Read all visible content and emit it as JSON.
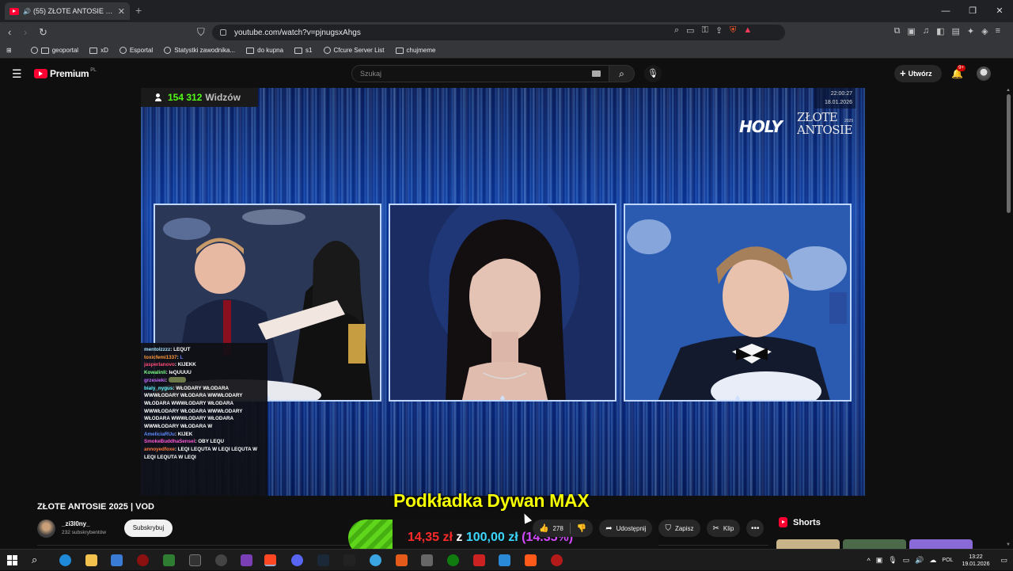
{
  "browser": {
    "tab_title": "(55) ZŁOTE ANTOSIE 2025 | V",
    "tab_close": "✕",
    "new_tab": "+",
    "window_controls": [
      "—",
      "❐",
      "✕"
    ],
    "url": "youtube.com/watch?v=pjnugsxAhgs",
    "bookmarks": [
      "geoportal",
      "xD",
      "Esportal",
      "Statystki zawodnika...",
      "do kupna",
      "s1",
      "Cfcure Server List",
      "chujmeme"
    ]
  },
  "youtube": {
    "logo_text": "Premium",
    "logo_suffix": "PL",
    "search_placeholder": "Szukaj",
    "create_label": "Utwórz",
    "notifications_badge": "9+"
  },
  "stream": {
    "viewers_count": "154 312",
    "viewers_label": "Widzów",
    "stamp_time": "22:00:27",
    "stamp_date": "18.01.2026",
    "brand_holy": "HOLY",
    "brand_line1": "ZŁOTE",
    "brand_line2": "ANTOSIE",
    "brand_year": "2025"
  },
  "chat": [
    {
      "user": "mentoIzzzz",
      "color": "#a7e3ff",
      "text": "LEQUT"
    },
    {
      "user": "toxicfemi1337",
      "color": "#ff9a3c",
      "text": "L"
    },
    {
      "user": "jasperlanovo",
      "color": "#ff4f7a",
      "text": "KIJEKK"
    },
    {
      "user": "Kowalinli",
      "color": "#7dff8a",
      "text": "IeQUUUU"
    },
    {
      "user": "grzesieki",
      "color": "#c56bff",
      "text": ""
    },
    {
      "user": "bialy_nygus",
      "color": "#62f7ff",
      "text": "WŁODARY WŁODARA WWWŁODARY WŁODARA WWWŁODARY WŁODARA WWWŁODARY WŁODARA WWWŁODARY WŁODARA WWWŁODARY WŁODARA WWWŁODARY WŁODARA WWWŁODARY WŁODARA W"
    },
    {
      "user": "AmeliciaRUu",
      "color": "#5f8bff",
      "text": "KIJEK"
    },
    {
      "user": "SmokeBuddhaSensei",
      "color": "#ff5ad8",
      "text": "OBY LEQU"
    },
    {
      "user": "annoyedfoxe",
      "color": "#ff7a3c",
      "text": "LEQI LEQUTA W LEQI LEQUTA W LEQI LEQUTA W LEQI"
    }
  ],
  "video": {
    "title": "ZŁOTE ANTOSIE 2025 | VOD",
    "channel": "_zi3l0ny_",
    "subscribers": "232 subskrybentów",
    "subscribe_label": "Subskrybuj",
    "likes": "278",
    "share_label": "Udostępnij",
    "save_label": "Zapisz",
    "clip_label": "Klip",
    "more_label": "•••"
  },
  "promo": {
    "title": "Podkładka Dywan MAX",
    "current": "14,35 zł",
    "of": "z",
    "goal": "100,00 zł",
    "percent": "(14.35%)",
    "progress": 0.1435
  },
  "shorts": {
    "label": "Shorts"
  },
  "taskbar": {
    "language": "POL",
    "time": "13:22",
    "date": "19.01.2026"
  },
  "colors": {
    "yt_red": "#ff0033",
    "kick_green": "#53fc18",
    "promo_yellow": "#f6ff00",
    "promo_current": "#ff2a2a",
    "promo_goal": "#3ad7ff",
    "promo_pct": "#d44bff"
  }
}
